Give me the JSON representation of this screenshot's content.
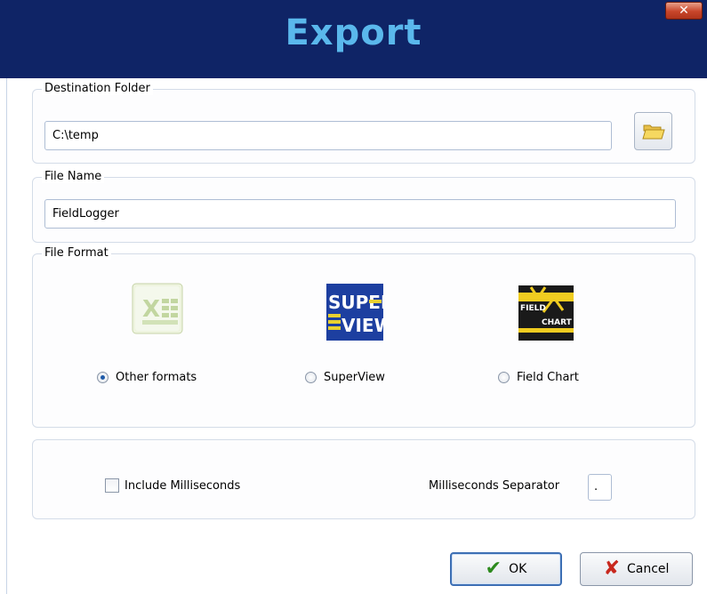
{
  "window": {
    "title": "Export",
    "close_glyph": "✕"
  },
  "destination": {
    "label": "Destination Folder",
    "path_value": "C:\\temp",
    "browse_icon": "folder-open-icon"
  },
  "file_name": {
    "label": "File Name",
    "value": "FieldLogger"
  },
  "file_format": {
    "label": "File Format",
    "options": [
      {
        "label": "Other formats",
        "icon": "excel-icon",
        "checked": true
      },
      {
        "label": "SuperView",
        "icon": "superview-icon",
        "checked": false
      },
      {
        "label": "Field Chart",
        "icon": "fieldchart-icon",
        "checked": false
      }
    ],
    "superview_logo_text": [
      "SUPER",
      "VIEW"
    ],
    "fieldchart_logo_text": [
      "FIELD",
      "CHART"
    ]
  },
  "options": {
    "include_ms_label": "Include Milliseconds",
    "include_ms_checked": false,
    "ms_separator_label": "Milliseconds Separator",
    "ms_separator_value": "."
  },
  "buttons": {
    "ok_label": "OK",
    "cancel_label": "Cancel"
  },
  "colors": {
    "titlebar": "#0f2466",
    "title_text": "#5ab8ec",
    "ok_check": "#2d8a1e",
    "cancel_x": "#c8281e"
  }
}
